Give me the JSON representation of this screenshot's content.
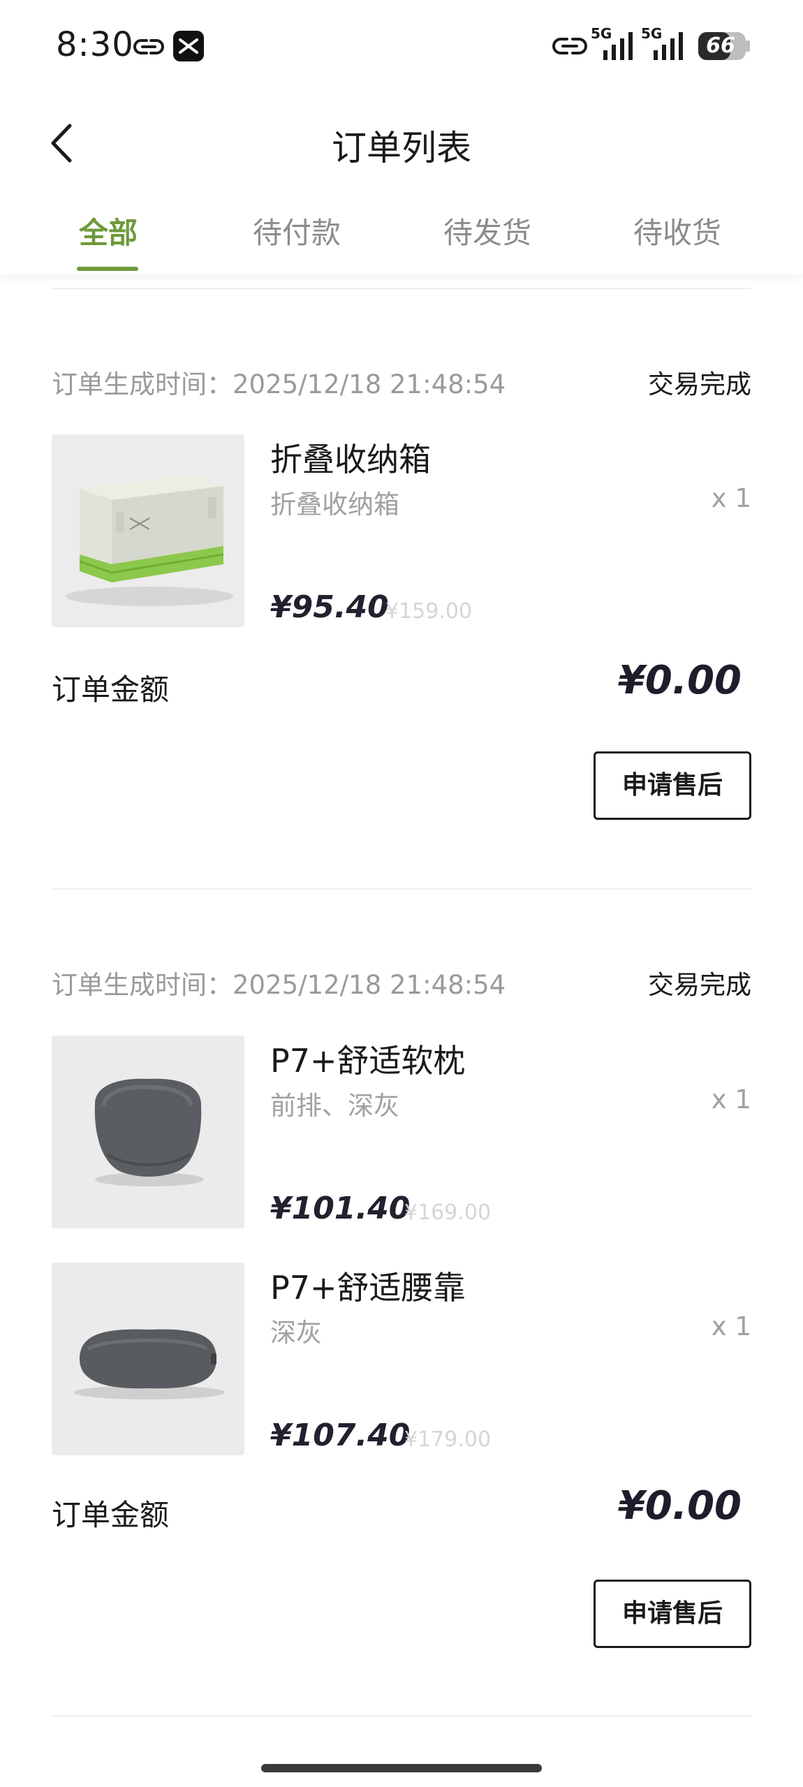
{
  "status_bar": {
    "time": "8:30",
    "battery": "66",
    "signal_1_label": "5G",
    "signal_2_label": "5G"
  },
  "header": {
    "title": "订单列表"
  },
  "tabs": [
    {
      "label": "全部",
      "active": true
    },
    {
      "label": "待付款",
      "active": false
    },
    {
      "label": "待发货",
      "active": false
    },
    {
      "label": "待收货",
      "active": false
    }
  ],
  "orders": [
    {
      "time_label": "订单生成时间：2025/12/18 21:48:54",
      "status": "交易完成",
      "items": [
        {
          "name": "折叠收纳箱",
          "spec": "折叠收纳箱",
          "qty": "x 1",
          "price": "¥95.40",
          "original_price": "¥159.00",
          "image": "storage-box"
        }
      ],
      "amount_label": "订单金额",
      "amount": "¥0.00",
      "button": "申请售后"
    },
    {
      "time_label": "订单生成时间：2025/12/18 21:48:54",
      "status": "交易完成",
      "items": [
        {
          "name": "P7+舒适软枕",
          "spec": "前排、深灰",
          "qty": "x 1",
          "price": "¥101.40",
          "original_price": "¥169.00",
          "image": "headrest-pillow"
        },
        {
          "name": "P7+舒适腰靠",
          "spec": "深灰",
          "qty": "x 1",
          "price": "¥107.40",
          "original_price": "¥179.00",
          "image": "lumbar-pillow"
        }
      ],
      "amount_label": "订单金额",
      "amount": "¥0.00",
      "button": "申请售后"
    }
  ],
  "colors": {
    "accent": "#6e9a3a",
    "text": "#1a1a1a",
    "muted": "#9a9a9a"
  }
}
